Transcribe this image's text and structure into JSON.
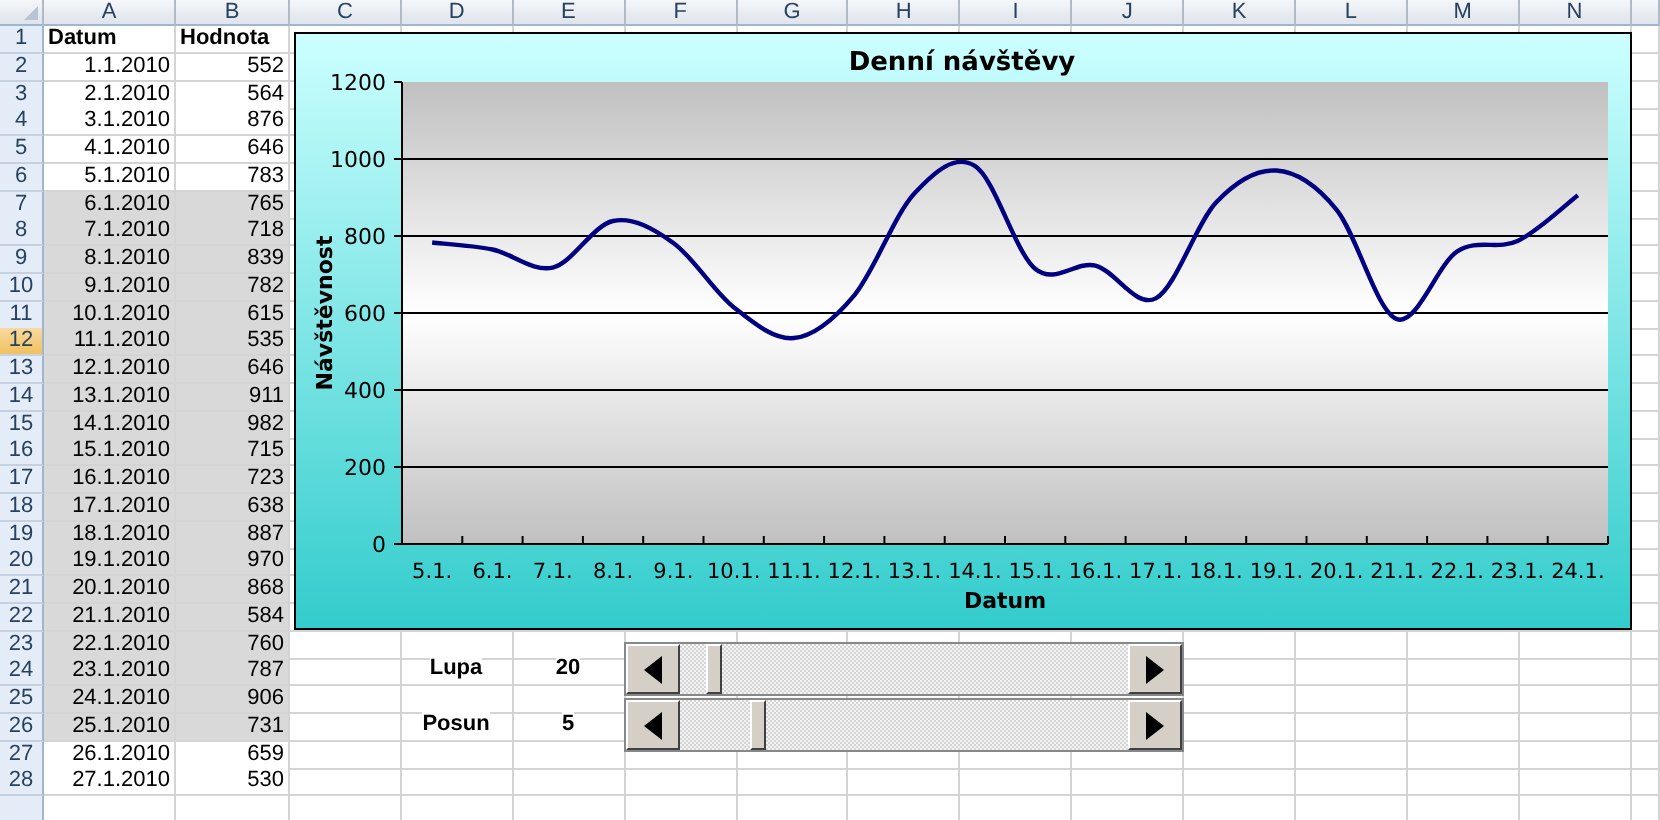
{
  "columns": [
    "A",
    "B",
    "C",
    "D",
    "E",
    "F",
    "G",
    "H",
    "I",
    "J",
    "K",
    "L",
    "M",
    "N"
  ],
  "rows": [
    {
      "number": "1",
      "kind": "header",
      "cells": [
        "Datum",
        "Hodnota"
      ],
      "highlighted": false,
      "active": false
    },
    {
      "number": "2",
      "kind": "data",
      "cells": [
        "1.1.2010",
        "552"
      ],
      "highlighted": false,
      "active": false
    },
    {
      "number": "3",
      "kind": "data",
      "cells": [
        "2.1.2010",
        "564"
      ],
      "highlighted": false,
      "active": false
    },
    {
      "number": "4",
      "kind": "data",
      "cells": [
        "3.1.2010",
        "876"
      ],
      "highlighted": false,
      "active": false
    },
    {
      "number": "5",
      "kind": "data",
      "cells": [
        "4.1.2010",
        "646"
      ],
      "highlighted": false,
      "active": false
    },
    {
      "number": "6",
      "kind": "data",
      "cells": [
        "5.1.2010",
        "783"
      ],
      "highlighted": false,
      "active": false
    },
    {
      "number": "7",
      "kind": "data",
      "cells": [
        "6.1.2010",
        "765"
      ],
      "highlighted": true,
      "active": false
    },
    {
      "number": "8",
      "kind": "data",
      "cells": [
        "7.1.2010",
        "718"
      ],
      "highlighted": true,
      "active": false
    },
    {
      "number": "9",
      "kind": "data",
      "cells": [
        "8.1.2010",
        "839"
      ],
      "highlighted": true,
      "active": false
    },
    {
      "number": "10",
      "kind": "data",
      "cells": [
        "9.1.2010",
        "782"
      ],
      "highlighted": true,
      "active": false
    },
    {
      "number": "11",
      "kind": "data",
      "cells": [
        "10.1.2010",
        "615"
      ],
      "highlighted": true,
      "active": false
    },
    {
      "number": "12",
      "kind": "data",
      "cells": [
        "11.1.2010",
        "535"
      ],
      "highlighted": true,
      "active": true
    },
    {
      "number": "13",
      "kind": "data",
      "cells": [
        "12.1.2010",
        "646"
      ],
      "highlighted": true,
      "active": false
    },
    {
      "number": "14",
      "kind": "data",
      "cells": [
        "13.1.2010",
        "911"
      ],
      "highlighted": true,
      "active": false
    },
    {
      "number": "15",
      "kind": "data",
      "cells": [
        "14.1.2010",
        "982"
      ],
      "highlighted": true,
      "active": false
    },
    {
      "number": "16",
      "kind": "data",
      "cells": [
        "15.1.2010",
        "715"
      ],
      "highlighted": true,
      "active": false
    },
    {
      "number": "17",
      "kind": "data",
      "cells": [
        "16.1.2010",
        "723"
      ],
      "highlighted": true,
      "active": false
    },
    {
      "number": "18",
      "kind": "data",
      "cells": [
        "17.1.2010",
        "638"
      ],
      "highlighted": true,
      "active": false
    },
    {
      "number": "19",
      "kind": "data",
      "cells": [
        "18.1.2010",
        "887"
      ],
      "highlighted": true,
      "active": false
    },
    {
      "number": "20",
      "kind": "data",
      "cells": [
        "19.1.2010",
        "970"
      ],
      "highlighted": true,
      "active": false
    },
    {
      "number": "21",
      "kind": "data",
      "cells": [
        "20.1.2010",
        "868"
      ],
      "highlighted": true,
      "active": false
    },
    {
      "number": "22",
      "kind": "data",
      "cells": [
        "21.1.2010",
        "584"
      ],
      "highlighted": true,
      "active": false
    },
    {
      "number": "23",
      "kind": "data",
      "cells": [
        "22.1.2010",
        "760"
      ],
      "highlighted": true,
      "active": false
    },
    {
      "number": "24",
      "kind": "data",
      "cells": [
        "23.1.2010",
        "787"
      ],
      "highlighted": true,
      "active": false
    },
    {
      "number": "25",
      "kind": "data",
      "cells": [
        "24.1.2010",
        "906"
      ],
      "highlighted": true,
      "active": false
    },
    {
      "number": "26",
      "kind": "data",
      "cells": [
        "25.1.2010",
        "731"
      ],
      "highlighted": true,
      "active": false
    },
    {
      "number": "27",
      "kind": "data",
      "cells": [
        "26.1.2010",
        "659"
      ],
      "highlighted": false,
      "active": false
    },
    {
      "number": "28",
      "kind": "data",
      "cells": [
        "27.1.2010",
        "530"
      ],
      "highlighted": false,
      "active": false
    }
  ],
  "chart": {
    "chart_data": {
      "type": "line",
      "title": "Denní návštěvy",
      "xlabel": "Datum",
      "ylabel": "Návštěvnost",
      "categories": [
        "5.1.",
        "6.1.",
        "7.1.",
        "8.1.",
        "9.1.",
        "10.1.",
        "11.1.",
        "12.1.",
        "13.1.",
        "14.1.",
        "15.1.",
        "16.1.",
        "17.1.",
        "18.1.",
        "19.1.",
        "20.1.",
        "21.1.",
        "22.1.",
        "23.1.",
        "24.1."
      ],
      "series": [
        {
          "color": "#000080",
          "values": [
            783,
            765,
            718,
            839,
            782,
            615,
            535,
            646,
            911,
            982,
            715,
            723,
            638,
            887,
            970,
            868,
            584,
            760,
            787,
            906
          ]
        }
      ],
      "grid": true,
      "ylim": [
        0,
        1200
      ],
      "yticks": [
        0,
        200,
        400,
        600,
        800,
        1000,
        1200
      ]
    }
  },
  "controls": [
    {
      "label": "Lupa",
      "value": "20",
      "level": 0.06
    },
    {
      "label": "Posun",
      "value": "5",
      "level": 0.16
    }
  ]
}
